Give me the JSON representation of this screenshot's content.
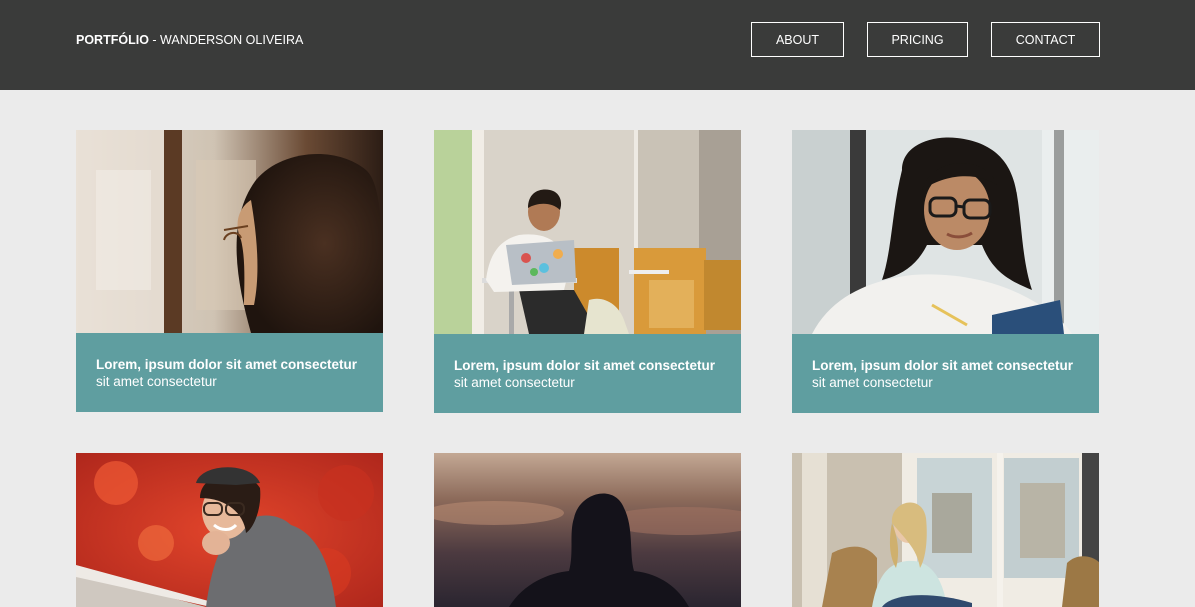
{
  "header": {
    "brand_bold": "PORTFÓLIO",
    "brand_rest": " - WANDERSON OLIVEIRA",
    "nav": {
      "about": "ABOUT",
      "pricing": "PRICING",
      "contact": "CONTACT"
    }
  },
  "cards": [
    {
      "title": "Lorem, ipsum dolor sit amet consectetur",
      "subtitle": "sit amet consectetur"
    },
    {
      "title": "Lorem, ipsum dolor sit amet consectetur",
      "subtitle": "sit amet consectetur"
    },
    {
      "title": "Lorem, ipsum dolor sit amet consectetur",
      "subtitle": "sit amet consectetur"
    }
  ],
  "colors": {
    "header_bg": "#3a3b3a",
    "page_bg": "#ebebeb",
    "caption_bg": "#5f9ea0"
  }
}
